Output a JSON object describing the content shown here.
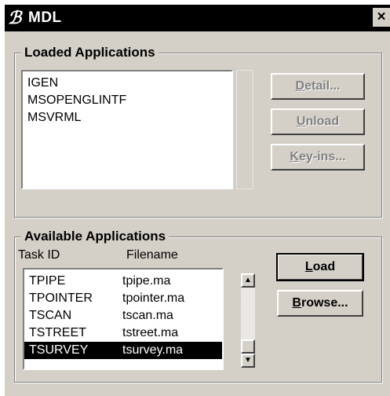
{
  "window": {
    "title": "MDL",
    "close_label": "×"
  },
  "loaded": {
    "label": "Loaded Applications",
    "items": [
      "IGEN",
      "MSOPENGLINTF",
      "MSVRML"
    ],
    "buttons": {
      "detail_u": "D",
      "detail_rest": "etail...",
      "unload_u": "U",
      "unload_rest": "nload",
      "keyins_u": "K",
      "keyins_rest": "ey-ins..."
    }
  },
  "available": {
    "label": "Available Applications",
    "headers": {
      "task": "Task ID",
      "file": "Filename"
    },
    "rows": [
      {
        "task": "TPIPE",
        "file": "tpipe.ma"
      },
      {
        "task": "TPOINTER",
        "file": "tpointer.ma"
      },
      {
        "task": "TSCAN",
        "file": "tscan.ma"
      },
      {
        "task": "TSTREET",
        "file": "tstreet.ma"
      },
      {
        "task": "TSURVEY",
        "file": "tsurvey.ma",
        "selected": true
      }
    ],
    "buttons": {
      "load_u": "L",
      "load_rest": "oad",
      "browse_u": "B",
      "browse_rest": "rowse..."
    },
    "scroll": {
      "up": "▲",
      "down": "▼"
    }
  }
}
